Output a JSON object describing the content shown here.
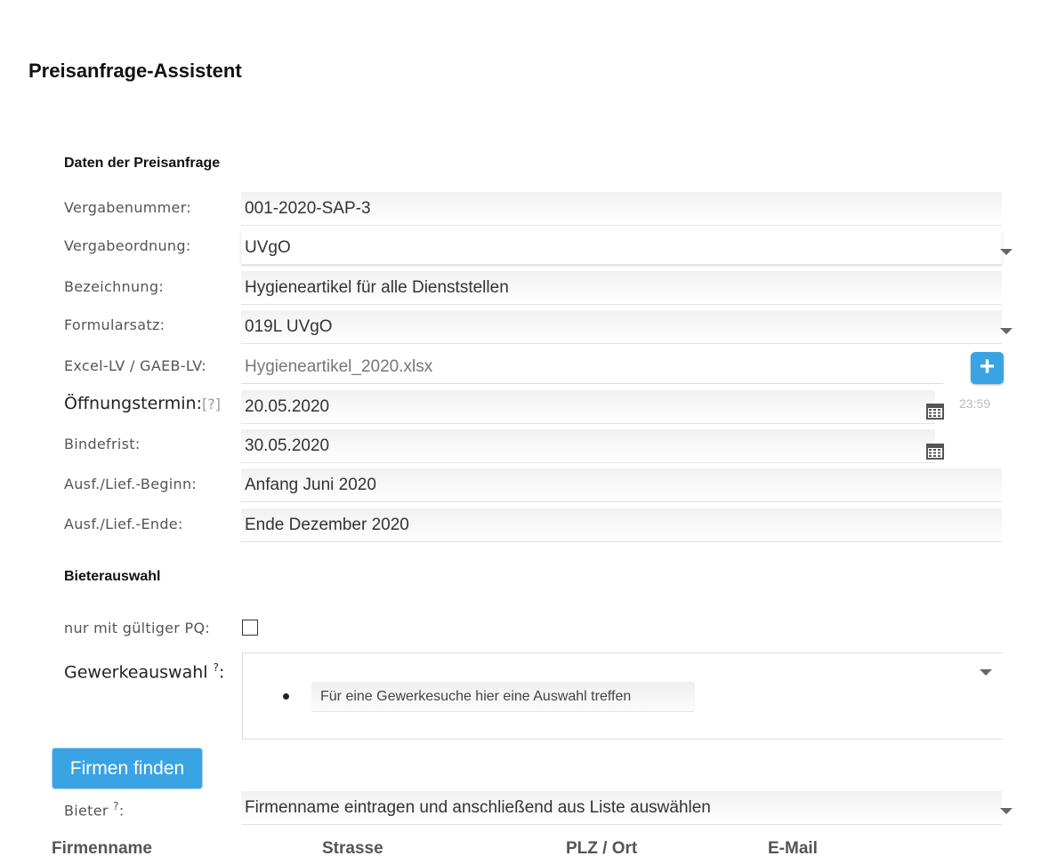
{
  "page_title": "Preisanfrage-Assistent",
  "section_data_title": "Daten der Preisanfrage",
  "fields": {
    "vergabenummer": {
      "label": "Vergabenummer:",
      "value": "001-2020-SAP-3"
    },
    "vergabeordnung": {
      "label": "Vergabeordnung:",
      "value": "UVgO"
    },
    "bezeichnung": {
      "label": "Bezeichnung:",
      "value": "Hygieneartikel für alle Dienststellen"
    },
    "formularsatz": {
      "label": "Formularsatz:",
      "value": "019L UVgO"
    },
    "excel_lv": {
      "label": "Excel-LV / GAEB-LV:",
      "value": "Hygieneartikel_2020.xlsx"
    },
    "oeffnungstermin": {
      "label": "Öffnungstermin:",
      "help": "[?]",
      "value": "20.05.2020",
      "time": "23:59"
    },
    "bindefrist": {
      "label": "Bindefrist:",
      "value": "30.05.2020"
    },
    "beginn": {
      "label": "Ausf./Lief.-Beginn:",
      "value": "Anfang Juni 2020"
    },
    "ende": {
      "label": "Ausf./Lief.-Ende:",
      "value": "Ende Dezember 2020"
    }
  },
  "section_bidder_title": "Bieterauswahl",
  "pq": {
    "label": "nur mit gültiger PQ:"
  },
  "gewerk": {
    "label": "Gewerkeauswahl",
    "help": "?",
    "colon": ":",
    "chip": "Für eine Gewerkesuche hier eine Auswahl treffen"
  },
  "find_button": "Firmen finden",
  "bieter": {
    "label": "Bieter",
    "help": "?",
    "colon": ":",
    "value": "Firmenname eintragen und anschließend aus Liste auswählen"
  },
  "table_headers": [
    "Firmenname",
    "Strasse",
    "PLZ / Ort",
    "E-Mail"
  ],
  "icons": {
    "add": "plus-icon",
    "calendar": "calendar-icon",
    "dropdown": "caret-down-icon"
  },
  "colors": {
    "accent": "#3aa3e3"
  }
}
